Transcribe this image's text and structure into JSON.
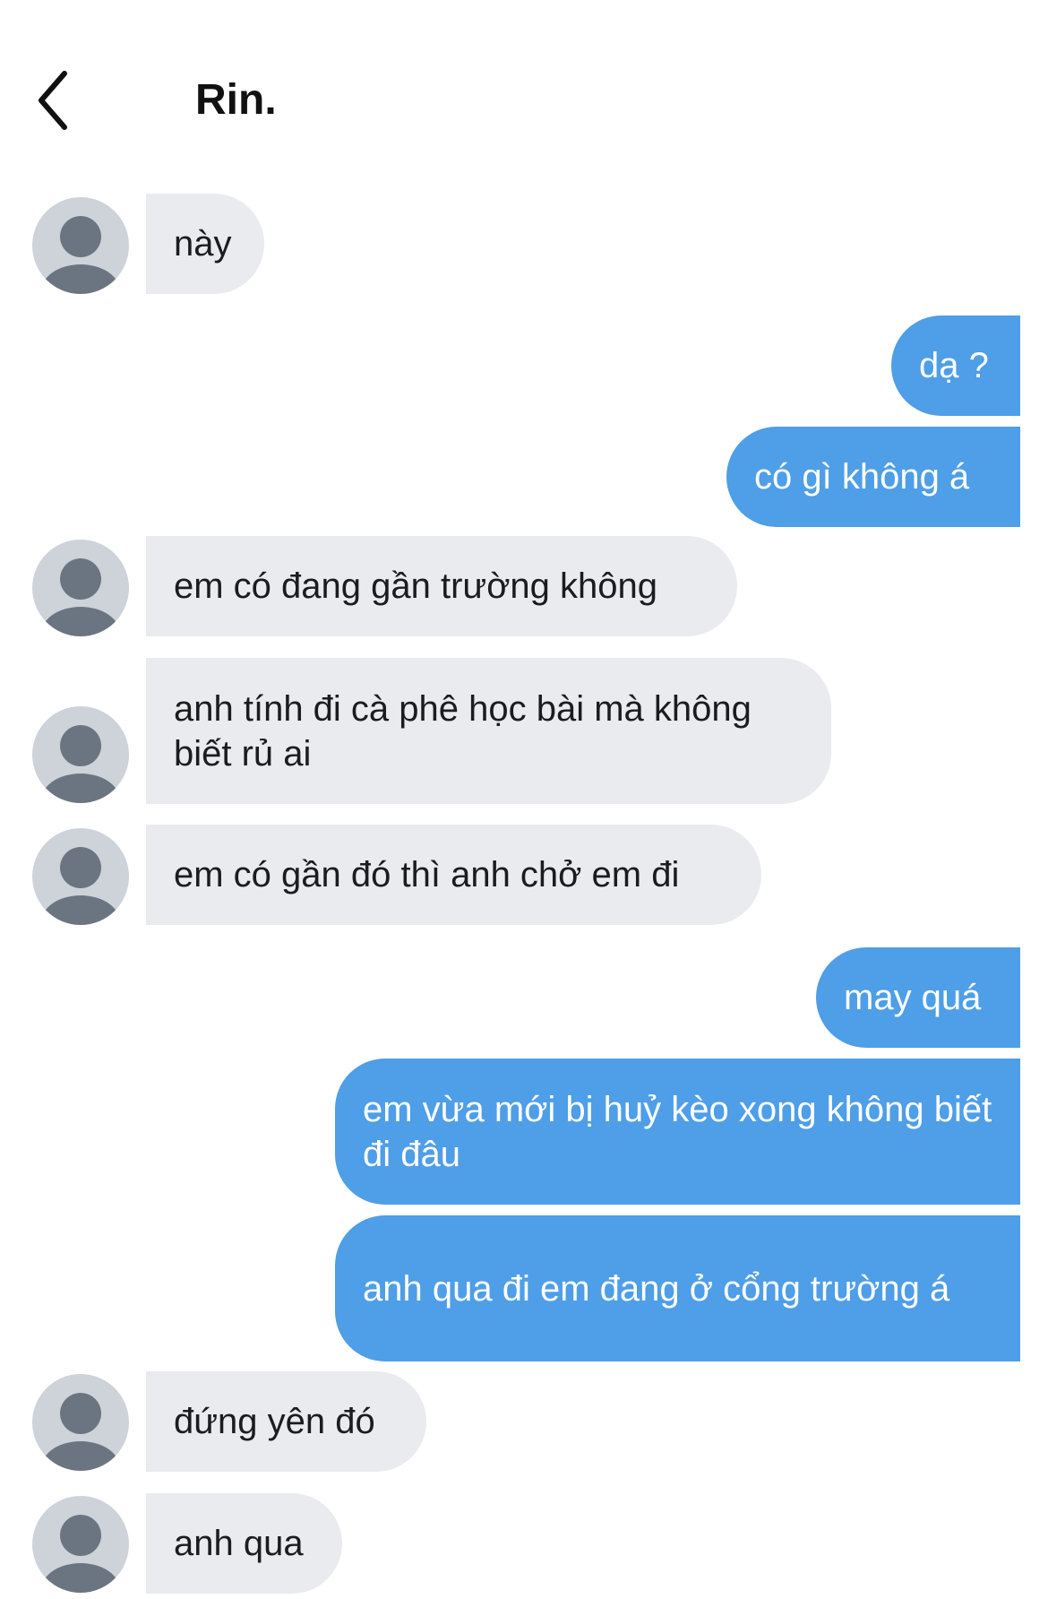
{
  "header": {
    "title": "Rin."
  },
  "messages": [
    {
      "side": "in",
      "text": "này"
    },
    {
      "side": "out",
      "text": "dạ ?"
    },
    {
      "side": "out",
      "text": "có gì không á"
    },
    {
      "side": "in",
      "text": "em có đang gần trường không"
    },
    {
      "side": "in",
      "text": "anh tính đi cà phê học bài mà không biết rủ ai"
    },
    {
      "side": "in",
      "text": "em có gần đó thì anh chở em đi"
    },
    {
      "side": "out",
      "text": "may quá"
    },
    {
      "side": "out",
      "text": "em vừa mới bị huỷ kèo xong không biết đi đâu"
    },
    {
      "side": "out",
      "text": "anh qua đi em đang ở cổng trường á"
    },
    {
      "side": "in",
      "text": "đứng yên đó"
    },
    {
      "side": "in",
      "text": "anh qua"
    }
  ]
}
